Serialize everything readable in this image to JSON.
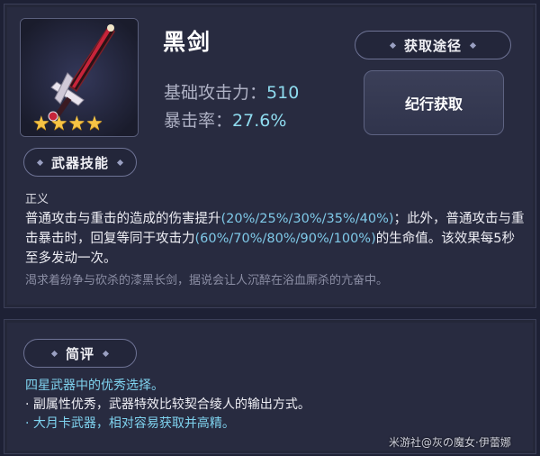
{
  "weapon": {
    "name": "黑剑",
    "stars": "★★★★",
    "stats": {
      "atk_label": "基础攻击力：",
      "atk_value": "510",
      "crit_label": "暴击率：",
      "crit_value": "27.6%"
    }
  },
  "obtain": {
    "header": "获取途径",
    "method": "纪行获取"
  },
  "skill": {
    "header": "武器技能",
    "name": "正义",
    "desc_parts": [
      "普通攻击与重击的造成的伤害提升",
      "(20%/25%/30%/35%/40%)",
      "；此外，普通攻击与重击暴击时，回复等同于攻击力",
      "(60%/70%/80%/90%/100%)",
      "的生命值。该效果每5秒至多发动一次。"
    ],
    "flavor": "渴求着纷争与砍杀的漆黑长剑，据说会让人沉醉在浴血厮杀的亢奋中。"
  },
  "review": {
    "header": "简评",
    "lines": [
      "四星武器中的优秀选择。",
      "· 副属性优秀，武器特效比较契合绫人的输出方式。",
      "· 大月卡武器，相对容易获取并高精。"
    ]
  },
  "watermark": "米游社@灰の魔女·伊蕾娜",
  "colors": {
    "background": "#1e2135",
    "panel": "#282b40",
    "highlight": "#7fc9e8",
    "star": "#f6c344"
  }
}
